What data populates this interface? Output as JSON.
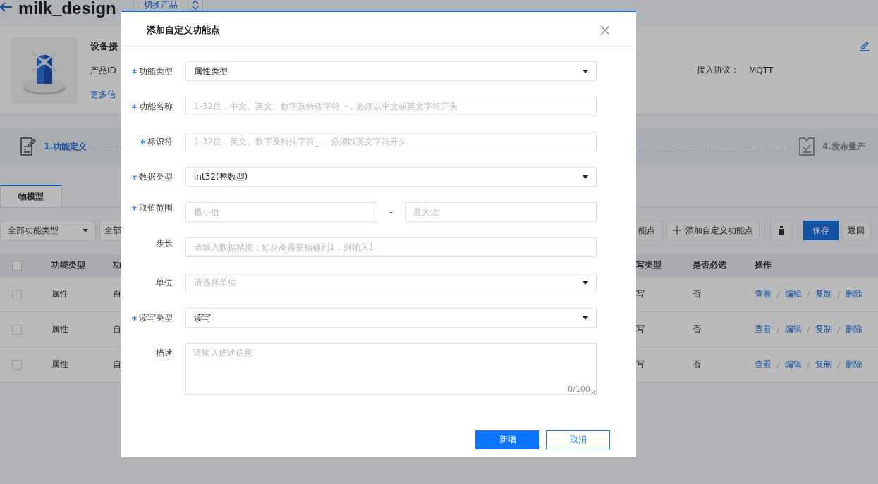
{
  "header": {
    "title": "milk_design",
    "switch_label": "切换产品"
  },
  "product": {
    "name": "设备接",
    "id_label": "产品ID",
    "more_link": "更多信",
    "protocol_label": "接入协议：",
    "protocol_value": "MQTT"
  },
  "steps": [
    {
      "label": "1.功能定义",
      "selected": true
    },
    {
      "label": "4.发布量产",
      "selected": false
    }
  ],
  "tabs": [
    {
      "label": "物模型",
      "selected": true
    }
  ],
  "filters": [
    "全部功能类型",
    "全部"
  ],
  "toolbar": {
    "partial_button": "能点",
    "add_button": "添加自定义功能点",
    "save": "保存",
    "back": "返回"
  },
  "table": {
    "header_checked": false,
    "columns_left": [
      "功能类型",
      "功"
    ],
    "columns_right": [
      "写类型",
      "是否必选",
      "操作"
    ],
    "rows": [
      {
        "checked": false,
        "type": "属性",
        "name": "自",
        "access": "写",
        "required": "否",
        "actions": [
          "查看",
          "编辑",
          "复制",
          "删除"
        ]
      },
      {
        "checked": false,
        "type": "属性",
        "name": "自",
        "access": "写",
        "required": "否",
        "actions": [
          "查看",
          "编辑",
          "复制",
          "删除"
        ]
      },
      {
        "checked": false,
        "type": "属性",
        "name": "自",
        "access": "写",
        "required": "否",
        "actions": [
          "查看",
          "编辑",
          "复制",
          "删除"
        ]
      }
    ]
  },
  "dialog": {
    "title": "添加自定义功能点",
    "fields": [
      {
        "kind": "select",
        "label": "功能类型",
        "required": true,
        "value": "属性类型"
      },
      {
        "kind": "input",
        "label": "功能名称",
        "required": true,
        "placeholder": "1-32位，中文、英文、数字及特殊字符_-，必须以中文或英文字符开头"
      },
      {
        "kind": "input",
        "label": "标识符",
        "required": true,
        "placeholder": "1-32位，英文、数字及特殊字符_-，必须以英文字符开头"
      },
      {
        "kind": "select",
        "label": "数据类型",
        "required": true,
        "value": "int32(整数型)"
      },
      {
        "kind": "range",
        "label": "取值范围",
        "required": true,
        "min_placeholder": "最小值",
        "separator": "-",
        "max_placeholder": "最大值"
      },
      {
        "kind": "input",
        "label": "步长",
        "required": false,
        "placeholder": "请输入数据精度；如身高需要精确到1，则输入1"
      },
      {
        "kind": "select",
        "label": "单位",
        "required": false,
        "placeholder": "请选择单位"
      },
      {
        "kind": "select",
        "label": "读写类型",
        "required": true,
        "value": "读写"
      },
      {
        "kind": "textarea",
        "label": "描述",
        "required": false,
        "placeholder": "请输入描述信息",
        "counter": "0/100"
      }
    ],
    "buttons": [
      {
        "label": "新增",
        "primary": true
      },
      {
        "label": "取消",
        "primary": false
      }
    ]
  }
}
